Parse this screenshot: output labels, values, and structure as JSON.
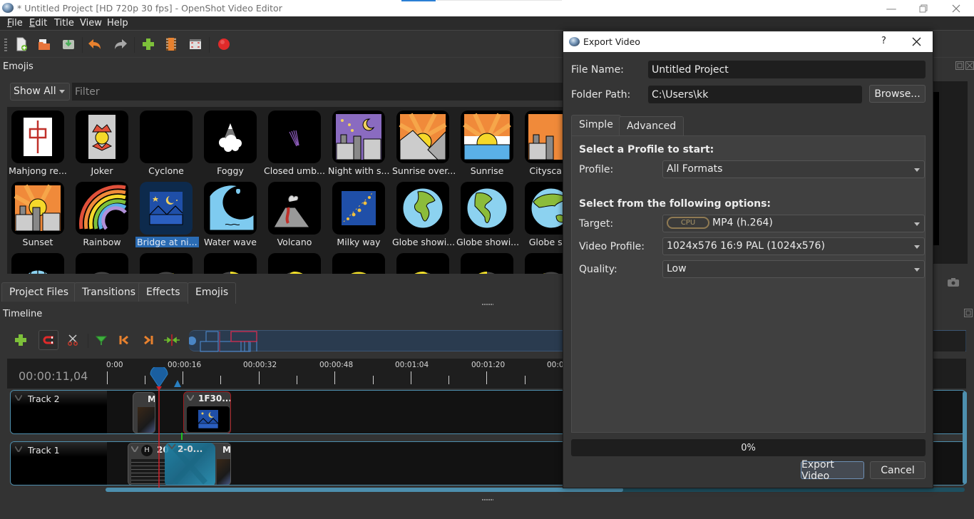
{
  "window": {
    "title": "* Untitled Project [HD 720p 30 fps] - OpenShot Video Editor",
    "minimize_icon": "minimize-icon",
    "restore_icon": "restore-icon",
    "close_icon": "close-icon"
  },
  "menu": [
    {
      "label": "File",
      "mnemonic": "F"
    },
    {
      "label": "Edit",
      "mnemonic": "E"
    },
    {
      "label": "Title"
    },
    {
      "label": "View"
    },
    {
      "label": "Help"
    }
  ],
  "toolbar": [
    {
      "name": "new-project",
      "icon": "new-file-icon"
    },
    {
      "name": "open-project",
      "icon": "folder-open-icon"
    },
    {
      "name": "save-project",
      "icon": "save-icon"
    },
    {
      "name": "undo",
      "icon": "undo-icon"
    },
    {
      "name": "redo",
      "icon": "redo-icon"
    },
    {
      "name": "import-files",
      "icon": "plus-icon"
    },
    {
      "name": "choose-profile",
      "icon": "film-icon"
    },
    {
      "name": "fullscreen",
      "icon": "fullscreen-icon"
    },
    {
      "name": "export-video",
      "icon": "record-icon"
    }
  ],
  "emojis_dock": {
    "title": "Emojis",
    "filter_select": "Show All",
    "filter_placeholder": "Filter",
    "items": [
      {
        "label": "Mahjong re...",
        "icon": "mahjong-red-dragon"
      },
      {
        "label": "Joker",
        "icon": "joker"
      },
      {
        "label": "Cyclone",
        "icon": "cyclone"
      },
      {
        "label": "Foggy",
        "icon": "foggy"
      },
      {
        "label": "Closed umb...",
        "icon": "closed-umbrella"
      },
      {
        "label": "Night with s...",
        "icon": "night-with-stars"
      },
      {
        "label": "Sunrise over...",
        "icon": "sunrise-over-mountains"
      },
      {
        "label": "Sunrise",
        "icon": "sunrise"
      },
      {
        "label": "Cityscape",
        "icon": "cityscape-dusk"
      },
      {
        "label": "Sunset",
        "icon": "sunset"
      },
      {
        "label": "Rainbow",
        "icon": "rainbow"
      },
      {
        "label": "Bridge at ni...",
        "icon": "bridge-at-night",
        "selected": true
      },
      {
        "label": "Water wave",
        "icon": "water-wave"
      },
      {
        "label": "Volcano",
        "icon": "volcano"
      },
      {
        "label": "Milky way",
        "icon": "milky-way"
      },
      {
        "label": "Globe showi...",
        "icon": "globe-europe-africa"
      },
      {
        "label": "Globe showi...",
        "icon": "globe-americas"
      },
      {
        "label": "Globe sho",
        "icon": "globe-asia-australia"
      },
      {
        "label": "",
        "icon": "globe-meridians"
      },
      {
        "label": "",
        "icon": "new-moon"
      },
      {
        "label": "",
        "icon": "waxing-crescent"
      },
      {
        "label": "",
        "icon": "first-quarter"
      },
      {
        "label": "",
        "icon": "waxing-gibbous"
      },
      {
        "label": "",
        "icon": "full-moon"
      },
      {
        "label": "",
        "icon": "waning-gibbous"
      },
      {
        "label": "",
        "icon": "last-quarter"
      },
      {
        "label": "",
        "icon": "waning-crescent"
      }
    ]
  },
  "dock_tabs": [
    {
      "label": "Project Files"
    },
    {
      "label": "Transitions"
    },
    {
      "label": "Effects"
    },
    {
      "label": "Emojis",
      "active": true
    }
  ],
  "timeline": {
    "title": "Timeline",
    "current_time": "00:00:11,04",
    "tools": [
      {
        "name": "add-track",
        "icon": "plus-icon"
      },
      {
        "name": "snap",
        "icon": "magnet-icon",
        "active": true
      },
      {
        "name": "razor",
        "icon": "scissors-icon"
      },
      {
        "name": "add-marker",
        "icon": "marker-icon"
      },
      {
        "name": "previous-marker",
        "icon": "jump-start-icon"
      },
      {
        "name": "next-marker",
        "icon": "jump-end-icon"
      },
      {
        "name": "center-playhead",
        "icon": "center-icon"
      }
    ],
    "ruler_labels": [
      "0:00",
      "00:00:16",
      "00:00:32",
      "00:00:48",
      "00:01:04",
      "00:01:20",
      "00:0"
    ],
    "tracks": [
      {
        "name": "Track 2",
        "clips": [
          {
            "title": "M"
          },
          {
            "title": "1F30...",
            "selected": true
          }
        ]
      },
      {
        "name": "Track 1",
        "clips": [
          {
            "title": "20",
            "badge": "H"
          },
          {
            "title": "2-0...",
            "transition": true
          },
          {
            "title": "M"
          }
        ]
      }
    ]
  },
  "export_dialog": {
    "title": "Export Video",
    "help": "?",
    "file_name_label": "File Name:",
    "file_name_value": "Untitled Project",
    "folder_path_label": "Folder Path:",
    "folder_path_value": "C:\\Users\\kk",
    "browse_label": "Browse...",
    "tabs": [
      {
        "label": "Simple",
        "active": true
      },
      {
        "label": "Advanced"
      }
    ],
    "profile_heading": "Select a Profile to start:",
    "profile_label": "Profile:",
    "profile_value": "All Formats",
    "options_heading": "Select from the following options:",
    "target_label": "Target:",
    "target_badge": "CPU",
    "target_value": "MP4 (h.264)",
    "video_profile_label": "Video Profile:",
    "video_profile_value": "1024x576 16:9 PAL (1024x576)",
    "quality_label": "Quality:",
    "quality_value": "Low",
    "progress_percent": 0,
    "progress_text": "0%",
    "export_button": "Export Video",
    "cancel_button": "Cancel"
  },
  "colors": {
    "accent_blue": "#4e8fae",
    "playhead_red": "#d0202a",
    "selection_blue": "#2a6bb3",
    "background": "#333333"
  }
}
